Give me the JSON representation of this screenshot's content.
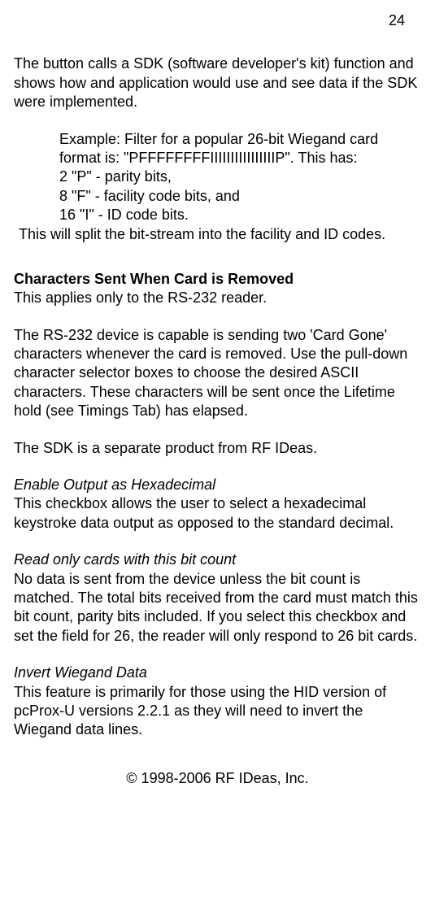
{
  "pageNumber": "24",
  "intro": "The button calls a SDK (software developer's kit) function and shows how and application would use and see data if the SDK were implemented.",
  "example": {
    "lead": "Example: Filter for a popular 26-bit Wiegand card format is: \"PFFFFFFFFIIIIIIIIIIIIIIIIP\". This has:",
    "line1": "2 \"P\" - parity bits,",
    "line2": "8 \"F\" - facility code bits, and",
    "line3": "16 \"I\" - ID code bits.",
    "tail": "This will split the bit-stream into the facility and ID codes."
  },
  "charsSent": {
    "heading": "Characters Sent When Card is Removed",
    "p1": "This applies only to the RS-232 reader.",
    "p2": "The RS-232 device is capable is sending two 'Card Gone' characters whenever the card is removed. Use the pull-down character selector boxes to choose the desired ASCII characters. These characters will be sent once the Lifetime hold (see Timings Tab) has elapsed.",
    "p3": "The SDK is a separate product from RF IDeas."
  },
  "enableHex": {
    "heading": "Enable Output as Hexadecimal",
    "body": "This checkbox allows the user to select a hexadecimal keystroke data output as opposed to the standard decimal."
  },
  "readOnly": {
    "heading": "Read only cards with this bit count",
    "body": "No data is sent from the device unless the bit count is matched. The total bits received from the card must match this bit count, parity bits included. If you select this checkbox and set the field for 26, the reader will only respond to 26 bit cards."
  },
  "invert": {
    "heading": "Invert Wiegand Data",
    "body": "This feature is primarily for those using the HID version of pcProx-U versions 2.2.1 as they will need to invert the Wiegand data lines."
  },
  "footer": "© 1998-2006 RF IDeas, Inc."
}
